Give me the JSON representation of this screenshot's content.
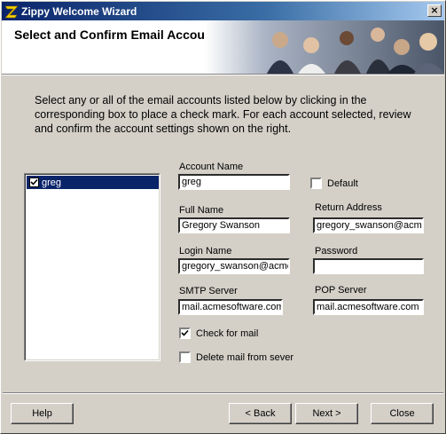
{
  "window": {
    "title": "Zippy Welcome Wizard"
  },
  "banner": {
    "heading": "Select and Confirm Email Accounts"
  },
  "intro": "Select any or all of the email accounts listed below by clicking in the corresponding box to place a check mark. For each account selected, review and confirm the account settings shown on the right.",
  "accounts": [
    {
      "name": "greg",
      "checked": true
    }
  ],
  "form": {
    "account_name_label": "Account Name",
    "account_name": "greg",
    "default_label": "Default",
    "full_name_label": "Full Name",
    "full_name": "Gregory Swanson",
    "return_address_label": "Return Address",
    "return_address": "gregory_swanson@acme",
    "login_name_label": "Login Name",
    "login_name": "gregory_swanson@acme",
    "password_label": "Password",
    "password": "",
    "smtp_label": "SMTP Server",
    "smtp": "mail.acmesoftware.com",
    "pop_label": "POP Server",
    "pop": "mail.acmesoftware.com",
    "check_mail_label": "Check for mail",
    "delete_mail_label": "Delete mail from sever"
  },
  "buttons": {
    "help": "Help",
    "back": "< Back",
    "next": "Next >",
    "close": "Close"
  }
}
